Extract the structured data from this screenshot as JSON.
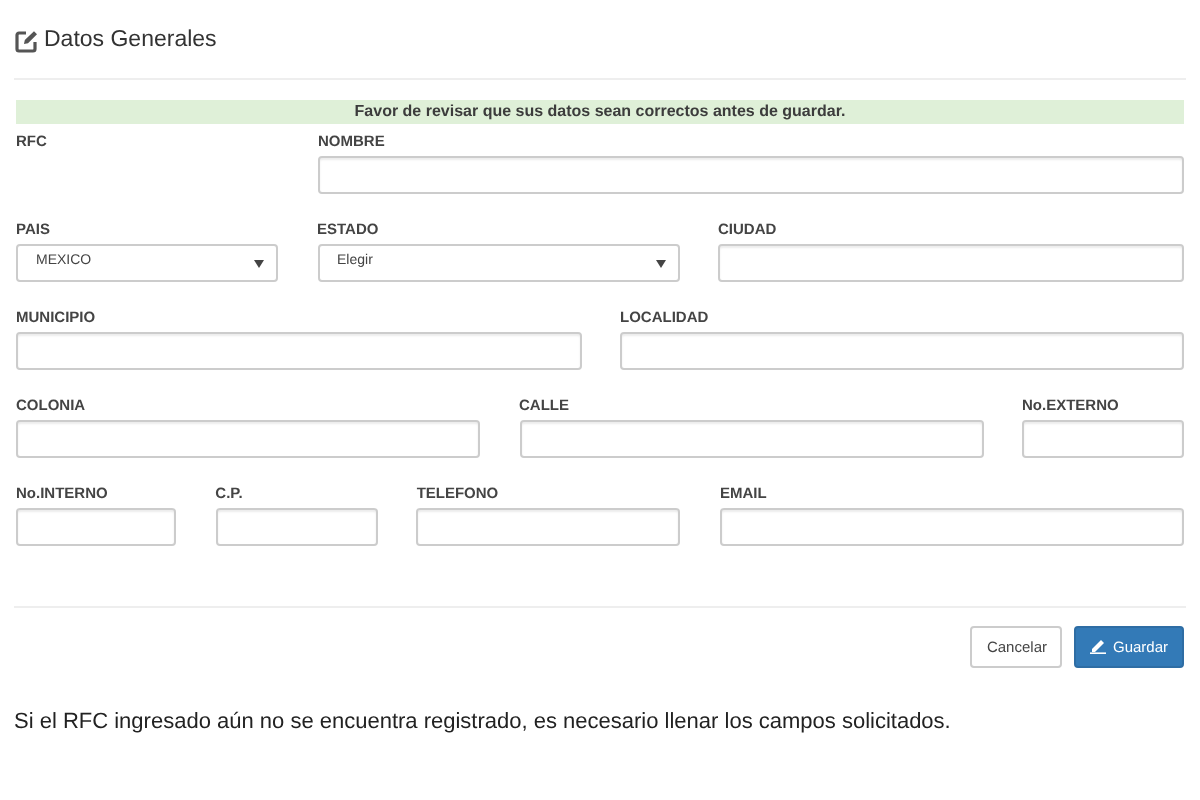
{
  "title": "Datos Generales",
  "notice": "Favor de revisar que sus datos sean correctos antes de guardar.",
  "rows": [
    [
      {
        "label": "RFC",
        "kind": "none"
      },
      {
        "label": "NOMBRE",
        "kind": "input"
      }
    ],
    [
      {
        "label": "PAIS",
        "kind": "select",
        "value": "MEXICO"
      },
      {
        "label": "ESTADO",
        "kind": "select",
        "value": "Elegir"
      },
      {
        "label": "CIUDAD",
        "kind": "input"
      }
    ],
    [
      {
        "label": "MUNICIPIO",
        "kind": "input"
      },
      {
        "label": "LOCALIDAD",
        "kind": "input"
      }
    ],
    [
      {
        "label": "COLONIA",
        "kind": "input"
      },
      {
        "label": "CALLE",
        "kind": "input"
      },
      {
        "label": "No.EXTERNO",
        "kind": "input"
      }
    ],
    [
      {
        "label": "No.INTERNO",
        "kind": "input"
      },
      {
        "label": "C.P.",
        "kind": "input"
      },
      {
        "label": "TELEFONO",
        "kind": "input"
      },
      {
        "label": "EMAIL",
        "kind": "input"
      }
    ]
  ],
  "buttons": [
    {
      "label": "Cancelar",
      "kind": "default"
    },
    {
      "label": "Guardar",
      "kind": "primary"
    }
  ],
  "note": "Si el RFC ingresado aún no se encuentra registrado, es necesario llenar los campos solicitados."
}
